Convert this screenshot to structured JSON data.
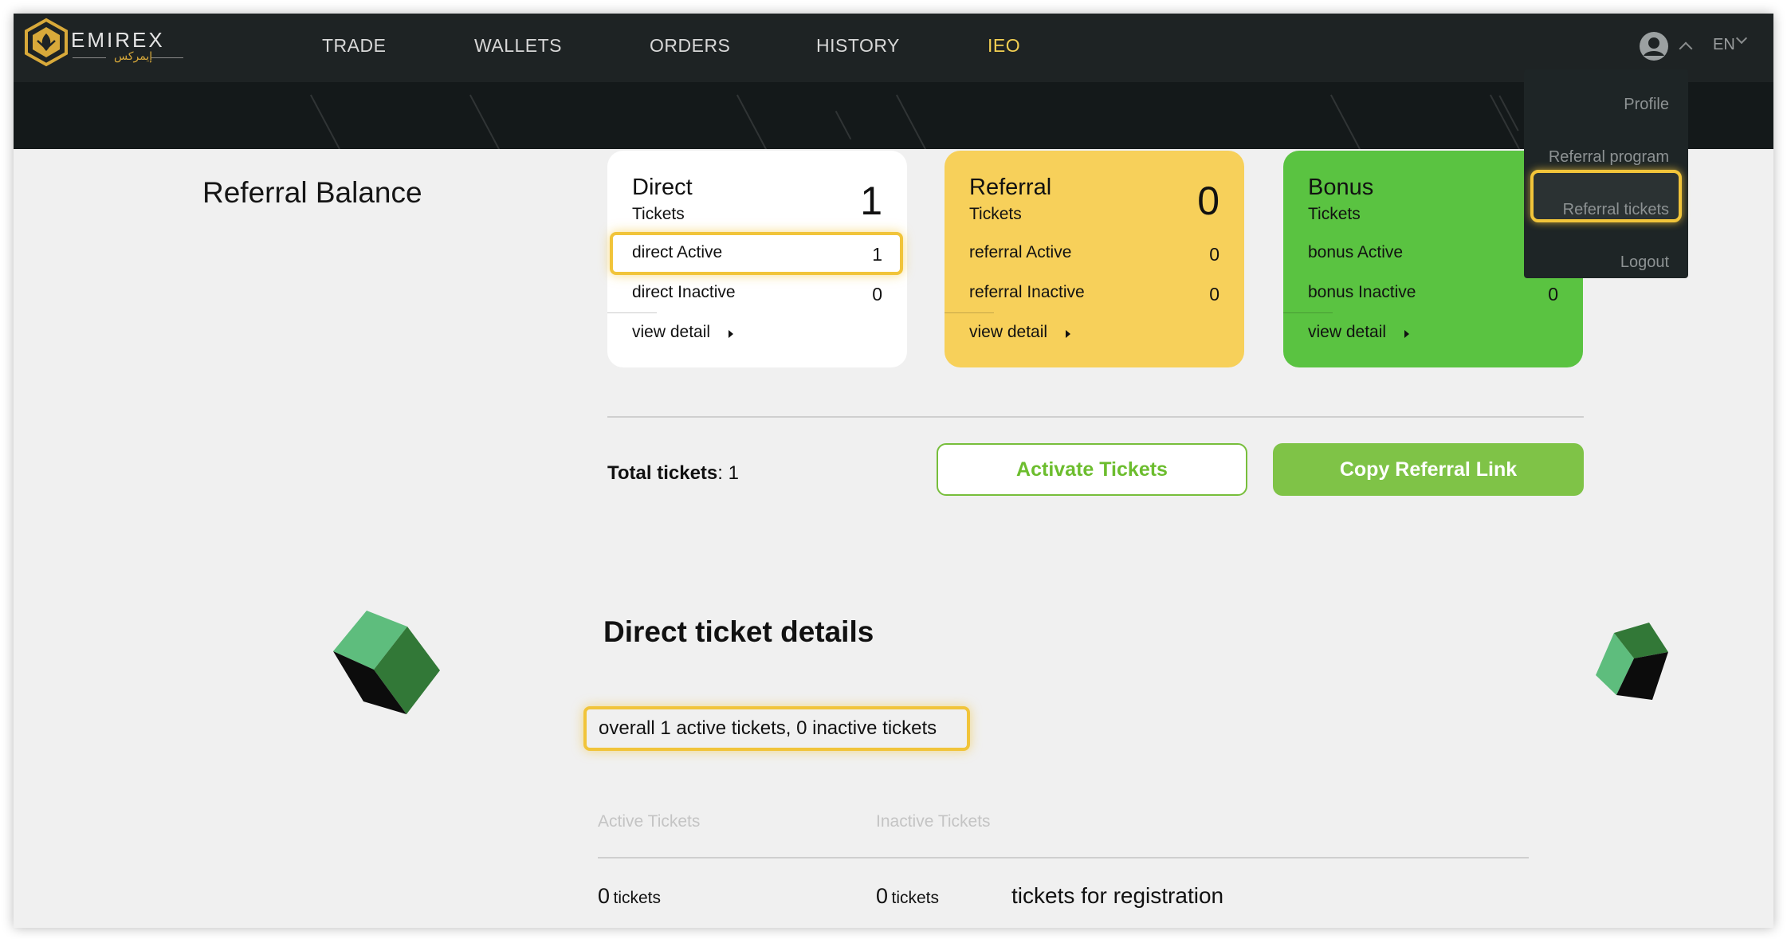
{
  "header": {
    "logo_text": "EMIREX",
    "logo_subtext": "إيمركس",
    "nav": [
      {
        "label": "TRADE"
      },
      {
        "label": "WALLETS"
      },
      {
        "label": "ORDERS"
      },
      {
        "label": "HISTORY"
      },
      {
        "label": "IEO"
      }
    ],
    "language": "EN"
  },
  "user_menu": {
    "items": [
      {
        "label": "Profile"
      },
      {
        "label": "Referral program"
      },
      {
        "label": "Referral tickets"
      },
      {
        "label": "Logout"
      }
    ],
    "highlighted": "Referral tickets"
  },
  "page": {
    "title": "Referral Balance"
  },
  "cards": [
    {
      "title": "Direct",
      "subtitle": "Tickets",
      "total": "1",
      "active_label": "direct Active",
      "active_value": "1",
      "inactive_label": "direct Inactive",
      "inactive_value": "0",
      "view_detail": "view detail",
      "color": "#ffffff"
    },
    {
      "title": "Referral",
      "subtitle": "Tickets",
      "total": "0",
      "active_label": "referral Active",
      "active_value": "0",
      "inactive_label": "referral Inactive",
      "inactive_value": "0",
      "view_detail": "view detail",
      "color": "#f7d05a"
    },
    {
      "title": "Bonus",
      "subtitle": "Tickets",
      "total": "",
      "active_label": "bonus Active",
      "active_value": "",
      "inactive_label": "bonus Inactive",
      "inactive_value": "0",
      "view_detail": "view detail",
      "color": "#5ac341"
    }
  ],
  "summary": {
    "total_label": "Total tickets",
    "total_value": ": 1",
    "activate_button": "Activate Tickets",
    "copy_button": "Copy Referral Link"
  },
  "details": {
    "title": "Direct ticket details",
    "overall": "overall 1 active tickets, 0 inactive tickets",
    "columns": [
      "Active Tickets",
      "Inactive Tickets"
    ],
    "active_count": "0",
    "inactive_count": "0",
    "unit": "tickets",
    "registration_text": "tickets for registration"
  },
  "colors": {
    "header_bg": "#1e2324",
    "accent_yellow": "#f1c43a",
    "ieo_color": "#f2cf52",
    "green_button": "#7fc347",
    "highlight_border": "#f1c43a"
  }
}
